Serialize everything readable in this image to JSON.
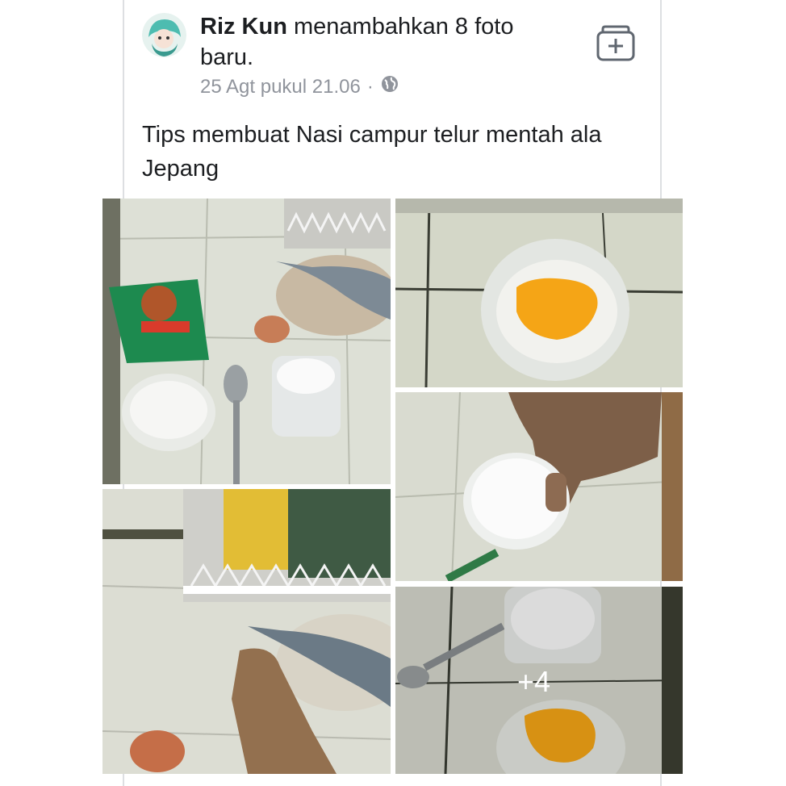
{
  "post": {
    "author_name": "Riz Kun",
    "action_text": "menambahkan 8 foto baru.",
    "timestamp": "25 Agt pukul 21.06",
    "separator": "·",
    "privacy_icon": "globe-icon",
    "save_icon": "save-collection-icon",
    "caption": "Tips membuat Nasi campur telur mentah ala Jepang",
    "more_photos_label": "+4"
  },
  "photos": [
    {
      "name": "photo-ingredients"
    },
    {
      "name": "photo-egg-rice-bowl"
    },
    {
      "name": "photo-salt-jar-finger"
    },
    {
      "name": "photo-dish-rack-fish"
    },
    {
      "name": "photo-spoon-salt-bowl"
    }
  ],
  "colors": {
    "text": "#1c1e21",
    "meta": "#90949c",
    "border": "#dddfe2"
  }
}
